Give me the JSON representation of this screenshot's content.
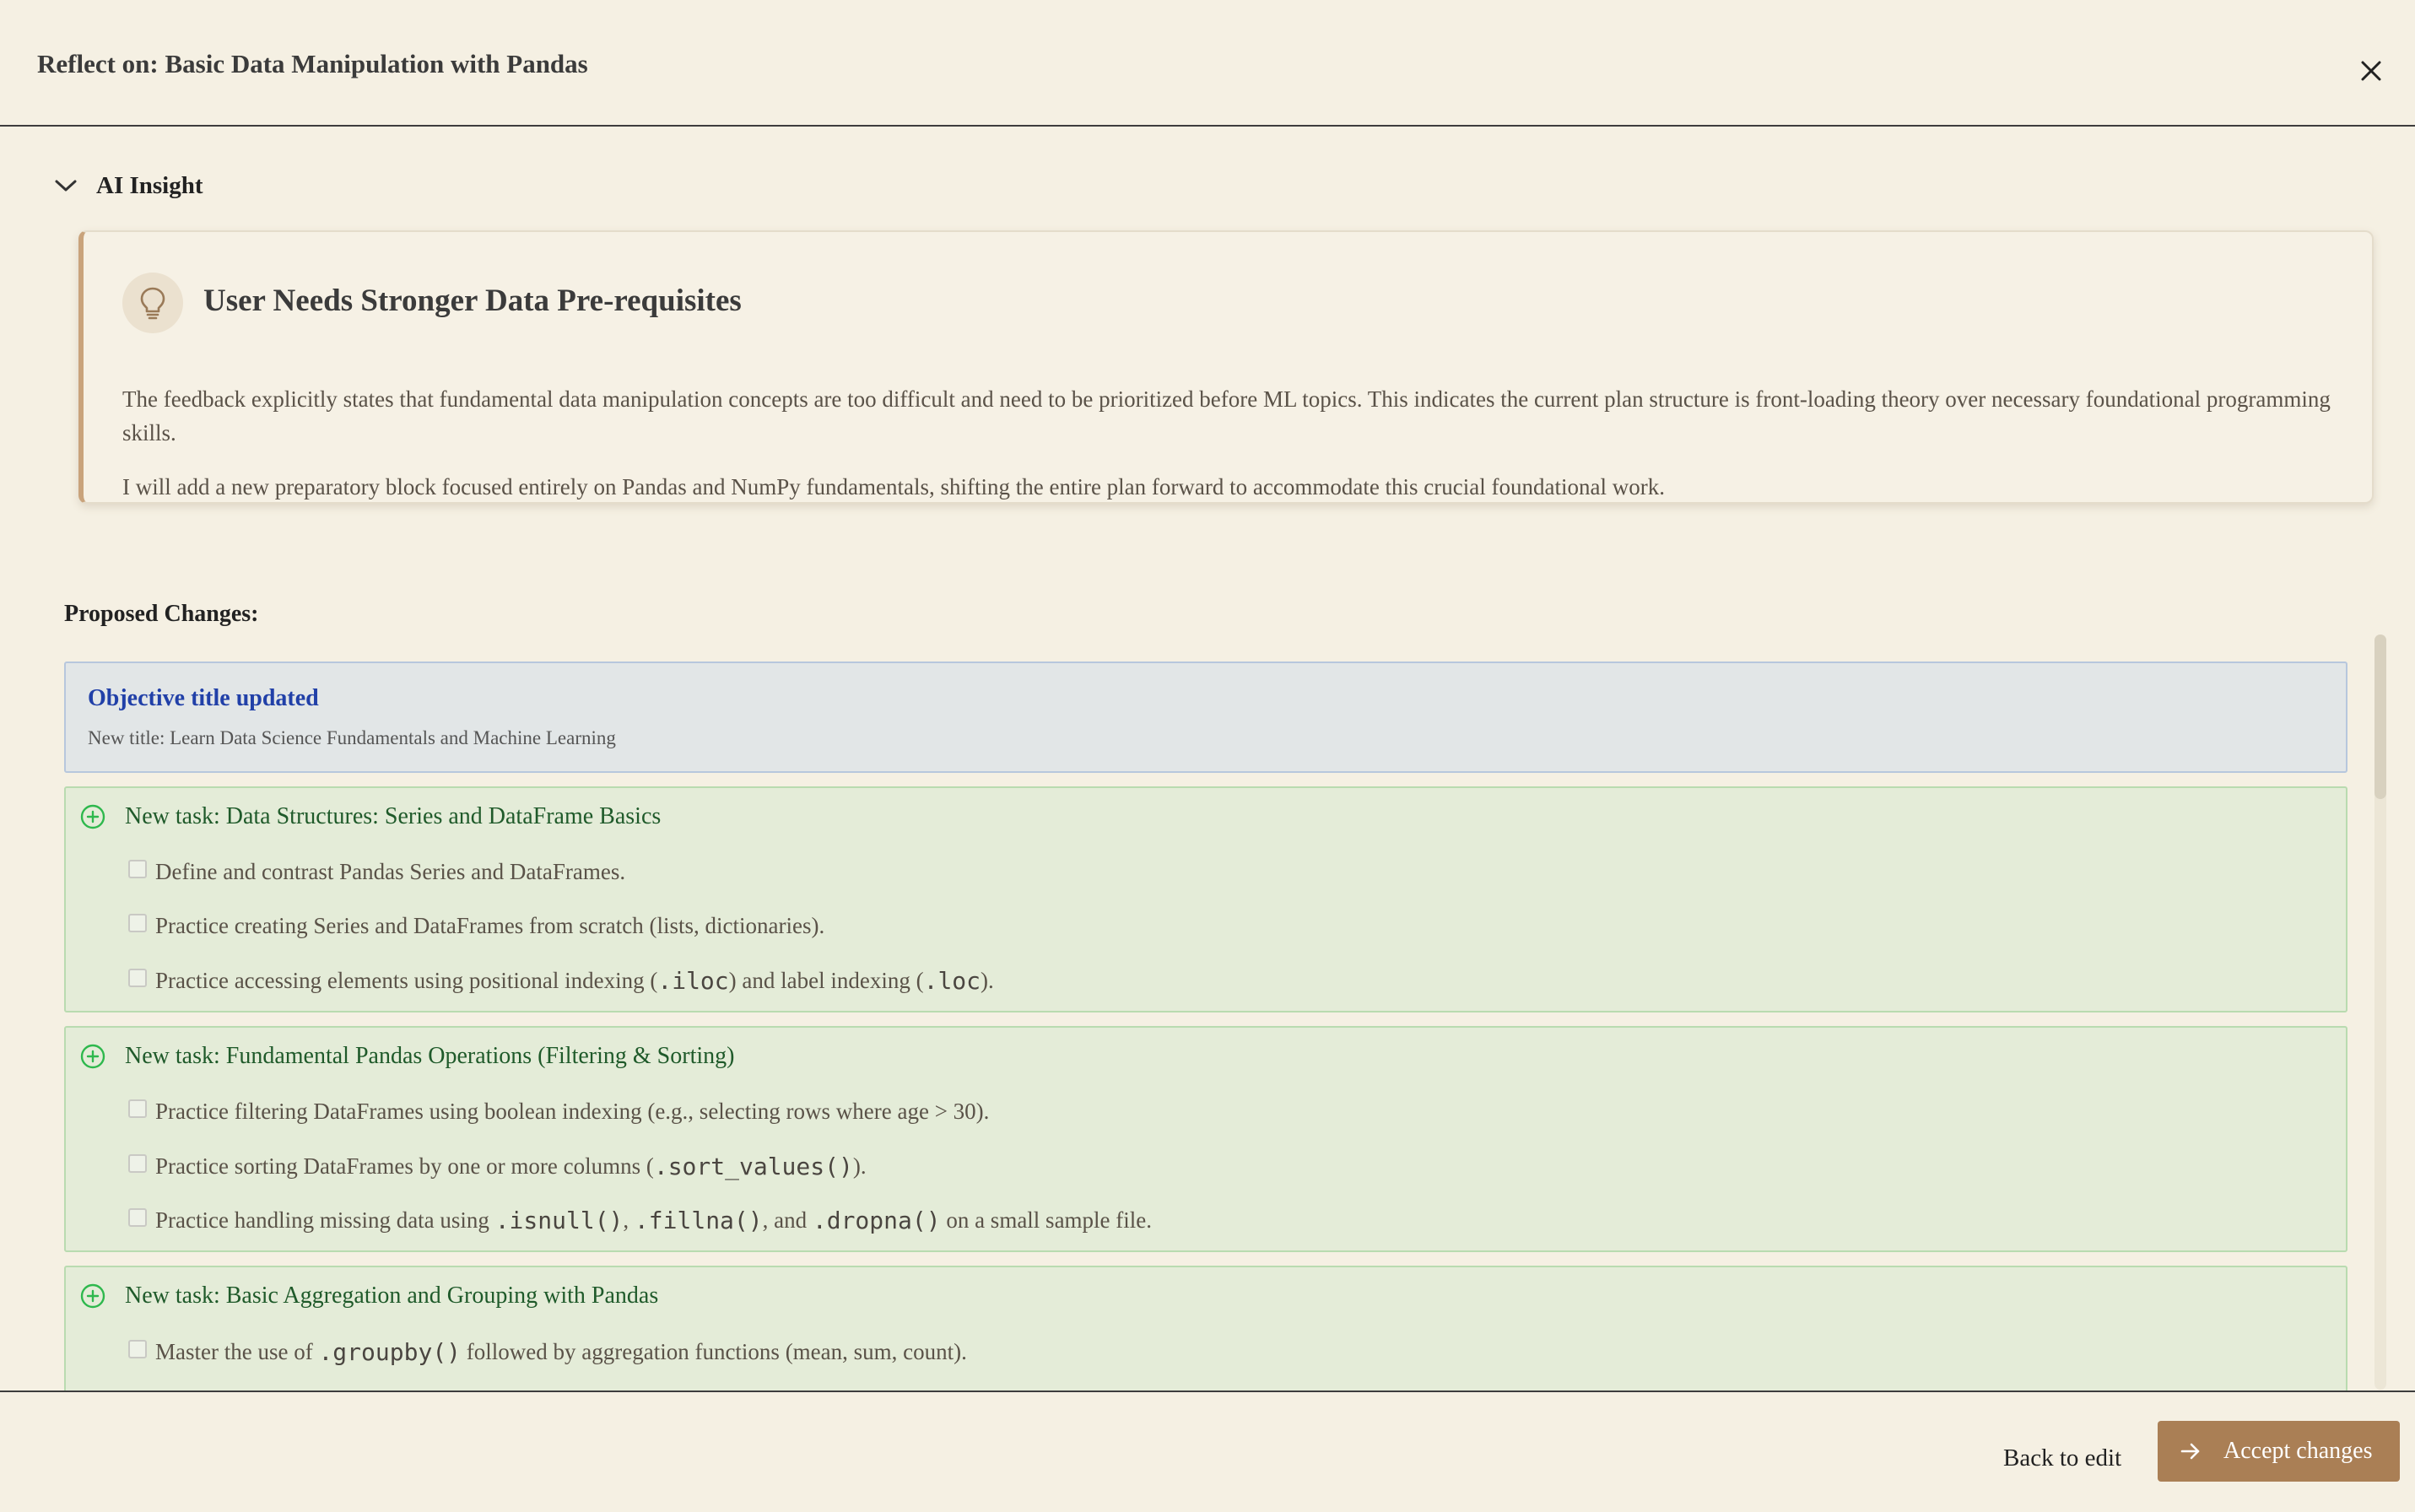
{
  "header": {
    "title": "Reflect on: Basic Data Manipulation with Pandas"
  },
  "insight": {
    "toggle_label": "AI Insight",
    "title": "User Needs Stronger Data Pre-requisites",
    "paragraph1": "The feedback explicitly states that fundamental data manipulation concepts are too difficult and need to be prioritized before ML topics. This indicates the current plan structure is front-loading theory over necessary foundational programming skills.",
    "paragraph2": "I will add a new preparatory block focused entirely on Pandas and NumPy fundamentals, shifting the entire plan forward to accommodate this crucial foundational work."
  },
  "proposed": {
    "label": "Proposed Changes:",
    "objective": {
      "title": "Objective title updated",
      "subtitle": "New title: Learn Data Science Fundamentals and Machine Learning"
    },
    "tasks": [
      {
        "title": "New task: Data Structures: Series and DataFrame Basics",
        "subtasks": [
          {
            "text_a": "Define and contrast Pandas Series and DataFrames."
          },
          {
            "text_a": "Practice creating Series and DataFrames from scratch (lists, dictionaries)."
          },
          {
            "text_a": "Practice accessing elements using positional indexing (",
            "code_a": ".iloc",
            "text_b": ") and label indexing (",
            "code_b": ".loc",
            "text_c": ")."
          }
        ]
      },
      {
        "title": "New task: Fundamental Pandas Operations (Filtering & Sorting)",
        "subtasks": [
          {
            "text_a": "Practice filtering DataFrames using boolean indexing (e.g., selecting rows where age > 30)."
          },
          {
            "text_a": "Practice sorting DataFrames by one or more columns (",
            "code_a": ".sort_values()",
            "text_b": ")."
          },
          {
            "text_a": "Practice handling missing data using ",
            "code_a": ".isnull()",
            "text_b": ", ",
            "code_b": ".fillna()",
            "text_c": ", and ",
            "code_c": ".dropna()",
            "text_d": " on a small sample file."
          }
        ]
      },
      {
        "title": "New task: Basic Aggregation and Grouping with Pandas",
        "subtasks": [
          {
            "text_a": "Master the use of ",
            "code_a": ".groupby()",
            "text_b": " followed by aggregation functions (mean, sum, count)."
          }
        ]
      }
    ]
  },
  "footer": {
    "back_label": "Back to edit",
    "accept_label": "Accept changes"
  },
  "colors": {
    "background": "#f5f0e3",
    "accent": "#aa7f55",
    "objective_title": "#2140a8",
    "task_title": "#1f5a2a",
    "plus_icon": "#2eb84d"
  }
}
